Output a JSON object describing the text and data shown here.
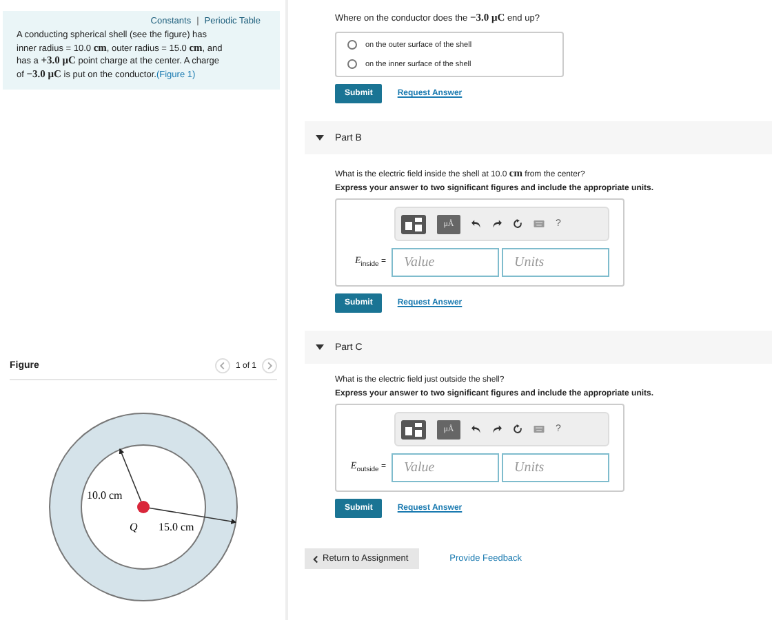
{
  "intro": {
    "links": [
      "Constants",
      "Periodic Table"
    ],
    "separator": "|",
    "text": "A conducting spherical shell (see the figure) has inner radius = 10.0 **cm**, outer radius = 15.0 **cm**, and has a **+3.0 μC** point charge at the center. A charge of **−3.0 μC** is put on the conductor.",
    "figure_link": "(Figure 1)"
  },
  "figure": {
    "title": "Figure",
    "pager": "1 of 1",
    "inner_label": "10.0 cm",
    "outer_label": "15.0 cm",
    "charge_label": "Q"
  },
  "part_a": {
    "question": "Where on the conductor does the **−3.0 μC** end up?",
    "options": [
      {
        "label": "on the outer surface of the shell",
        "selected": false
      },
      {
        "label": "on the inner surface of the shell",
        "selected": false
      }
    ],
    "submit": "Submit",
    "request": "Request Answer"
  },
  "parts": [
    {
      "title": "Part B",
      "expanded": true,
      "question": "What is the electric field inside the shell at 10.0 **cm** from the center?",
      "instruction": "Express your answer to two significant figures and include the appropriate units.",
      "units_button": "μÅ",
      "help": "?",
      "label": "*E*$_{inside}$ =",
      "value_placeholder": "Value",
      "units_placeholder": "Units",
      "submit": "Submit",
      "request": "Request Answer"
    },
    {
      "title": "Part C",
      "expanded": true,
      "question": "What is the electric field just outside the shell?",
      "instruction": "Express your answer to two significant figures and include the appropriate units.",
      "units_button": "μÅ",
      "help": "?",
      "label": "*E*$_{outside}$ =",
      "value_placeholder": "Value",
      "units_placeholder": "Units",
      "submit": "Submit",
      "request": "Request Answer"
    }
  ],
  "footer": {
    "return": "Return to Assignment",
    "feedback": "Provide Feedback"
  }
}
